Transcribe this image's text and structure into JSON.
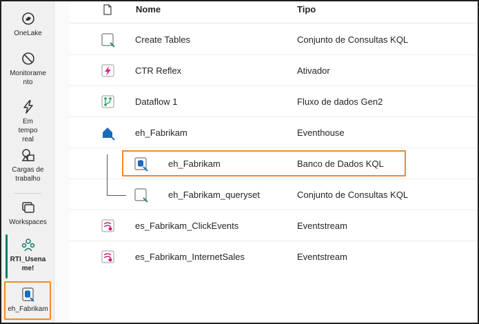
{
  "rail": {
    "items": [
      {
        "label": "OneLake",
        "icon": "onelake-icon"
      },
      {
        "label": "Monitoramento",
        "icon": "monitor-icon"
      },
      {
        "label": "Em tempo real",
        "icon": "lightning-icon"
      },
      {
        "label": "Cargas de trabalho",
        "icon": "workloads-icon"
      },
      {
        "label": "Workspaces",
        "icon": "workspaces-icon"
      },
      {
        "label": "RTI_Usename!",
        "icon": "workspace-people-icon"
      },
      {
        "label": "eh_Fabrikam",
        "icon": "kql-database-icon"
      }
    ]
  },
  "table": {
    "headers": {
      "name": "Nome",
      "type": "Tipo"
    },
    "rows": [
      {
        "name": "Create Tables",
        "type": "Conjunto de Consultas KQL",
        "icon": "kql-queryset-icon"
      },
      {
        "name": "CTR Reflex",
        "type": "Ativador",
        "icon": "activator-icon"
      },
      {
        "name": "Dataflow 1",
        "type": "Fluxo de dados Gen2",
        "icon": "dataflow-icon"
      },
      {
        "name": "eh_Fabrikam",
        "type": "Eventhouse",
        "icon": "eventhouse-icon"
      },
      {
        "name": "eh_Fabrikam",
        "type": "Banco de Dados KQL",
        "icon": "kql-database-icon"
      },
      {
        "name": "eh_Fabrikam_queryset",
        "type": "Conjunto de Consultas KQL",
        "icon": "kql-queryset-icon"
      },
      {
        "name": "es_Fabrikam_ClickEvents",
        "type": "Eventstream",
        "icon": "eventstream-icon"
      },
      {
        "name": "es_Fabrikam_InternetSales",
        "type": "Eventstream",
        "icon": "eventstream-icon"
      }
    ]
  },
  "colors": {
    "highlight": "#f08a24",
    "accent": "#117865"
  }
}
